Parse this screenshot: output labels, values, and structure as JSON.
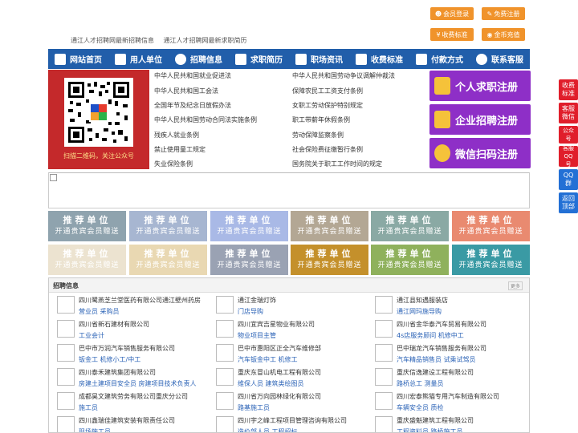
{
  "header_links": [
    "通江人才招聘网最新招聘信息",
    "通江人才招聘网最新求职简历"
  ],
  "top_buttons": [
    {
      "label": "会员登录",
      "icon": "user-icon"
    },
    {
      "label": "免费注册",
      "icon": "register-icon"
    },
    {
      "label": "收费标准",
      "icon": "price-icon"
    },
    {
      "label": "金币充值",
      "icon": "coin-icon"
    }
  ],
  "nav": [
    {
      "label": "网站首页",
      "icon": "home-icon"
    },
    {
      "label": "用人单位",
      "icon": "building-icon"
    },
    {
      "label": "招聘信息",
      "icon": "recruit-icon"
    },
    {
      "label": "求职简历",
      "icon": "resume-icon"
    },
    {
      "label": "职场资讯",
      "icon": "news-icon"
    },
    {
      "label": "收费标准",
      "icon": "price-icon"
    },
    {
      "label": "付款方式",
      "icon": "payment-icon"
    },
    {
      "label": "联系客服",
      "icon": "service-icon"
    }
  ],
  "qr_caption": "扫描二维码，关注公众号",
  "laws": [
    "中华人民共和国就业促进法",
    "中华人民共和国劳动争议调解仲裁法",
    "中华人民共和国工会法",
    "保障农民工工资支付条例",
    "全国年节及纪念日放假办法",
    "女职工劳动保护特别规定",
    "中华人民共和国劳动合同法实施条例",
    "职工带薪年休假条例",
    "残疾人就业条例",
    "劳动保障监察条例",
    "禁止使用童工规定",
    "社会保险费征缴暂行条例",
    "失业保险条例",
    "国务院关于职工工作时间的规定"
  ],
  "register_buttons": [
    {
      "label": "个人求职注册",
      "icon": "person-icon"
    },
    {
      "label": "企业招聘注册",
      "icon": "company-icon"
    },
    {
      "label": "微信扫码注册",
      "icon": "wechat-icon"
    }
  ],
  "side_buttons": [
    "收费标准",
    "客服微信",
    "公众号",
    "客服QQ号",
    "QQ群",
    "返回顶部"
  ],
  "recommend": {
    "title": "推荐单位",
    "subtitle": "开通贵宾会员赠送"
  },
  "recommend_colors": [
    "#8fa3ae",
    "#a7b6d1",
    "#a9b9e6",
    "#b3a794",
    "#8aa9a4",
    "#e98a70",
    "#ece3d0",
    "#e9d8b2",
    "#9aa2b3",
    "#c4902b",
    "#8fb15c",
    "#3a9aa4"
  ],
  "jobs_section": {
    "title": "招聘信息",
    "more": "更多"
  },
  "jobs": [
    {
      "company": "四川鹭燕芝兰堂医药有限公司通江壁州药房",
      "positions": "营业员 采购员"
    },
    {
      "company": "通江金瑞灯饰",
      "positions": "门店导购"
    },
    {
      "company": "通江县知遇服装店",
      "positions": "通江网玛施导购"
    },
    {
      "company": "四川省新石建材有限公司",
      "positions": "工业会计"
    },
    {
      "company": "四川宜宾吉星物业有限公司",
      "positions": "物业项目主管"
    },
    {
      "company": "四川省金华泰汽车贸易有限公司",
      "positions": "4s店服务顾问 机修中工"
    },
    {
      "company": "巴中市万润汽车销售服务有限公司",
      "positions": "钣金工 机修小工/中工"
    },
    {
      "company": "巴中市惠阳区正全汽车维修部",
      "positions": "汽车钣金中工 机修工"
    },
    {
      "company": "巴中瑞龙汽车销售服务有限公司",
      "positions": "汽车精品销售员 试乘试驾员"
    },
    {
      "company": "四川泰禾建筑集团有限公司",
      "positions": "房建土建项目安全员 房建项目技术负责人"
    },
    {
      "company": "重庆东冒山机电工程有限公司",
      "positions": "维保人员 建筑类绘图员"
    },
    {
      "company": "重庆信逸建设工程有限公司",
      "positions": "路桥总工 测量员"
    },
    {
      "company": "成都昊文建筑劳务有限公司重庆分公司",
      "positions": "施工员"
    },
    {
      "company": "四川省万向园林绿化有限公司",
      "positions": "路基施工员"
    },
    {
      "company": "四川宏泰熊猫专用汽车制造有限公司",
      "positions": "车辆安全员 质检"
    },
    {
      "company": "四川鑫瑞佳建筑安装有限责任公司",
      "positions": "现场施工员"
    },
    {
      "company": "四川宇之峰工程项目管理咨询有限公司",
      "positions": "造价部人员 工程招标"
    },
    {
      "company": "重庆盛魁建筑工程有限公司",
      "positions": "工程资料员 路桥施工员"
    }
  ]
}
